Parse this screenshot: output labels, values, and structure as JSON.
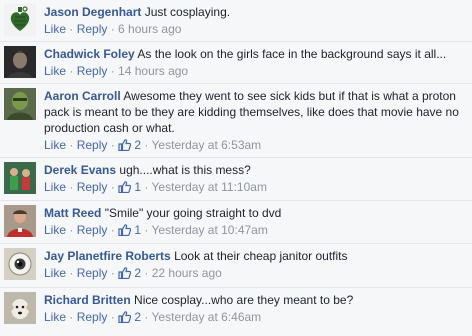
{
  "actions": {
    "like": "Like",
    "reply": "Reply",
    "sep": " · "
  },
  "comments": [
    {
      "author": "Jason Degenhart",
      "text": "Just cosplaying.",
      "likes": "",
      "time": "6 hours ago",
      "avatar_icon": "grenade-heart-icon",
      "avatar_bg": "#2e5a2a"
    },
    {
      "author": "Chadwick Foley",
      "text": "As the look on the girls face in the background says it all...",
      "likes": "",
      "time": "14 hours ago",
      "avatar_icon": "man-portrait-icon",
      "avatar_bg": "#2a2a2a"
    },
    {
      "author": "Aaron Carroll",
      "text": "Awesome they went to see sick kids but if that is what a proton pack is meant to be they are kidding themselves, like does that movie have no production cash or what.",
      "likes": "2",
      "time": "Yesterday at 6:53am",
      "avatar_icon": "green-character-icon",
      "avatar_bg": "#6a8a4a"
    },
    {
      "author": "Derek Evans",
      "text": "ugh....what is this mess?",
      "likes": "1",
      "time": "Yesterday at 11:10am",
      "avatar_icon": "costume-figures-icon",
      "avatar_bg": "#4a8a5a"
    },
    {
      "author": "Matt Reed",
      "text": "\"Smile\" your going straight to dvd",
      "likes": "1",
      "time": "Yesterday at 10:47am",
      "avatar_icon": "man-red-shirt-icon",
      "avatar_bg": "#9a8a7a"
    },
    {
      "author": "Jay Planetfire Roberts",
      "text": "Look at their cheap janitor outfits",
      "likes": "2",
      "time": "22 hours ago",
      "avatar_icon": "eyeball-icon",
      "avatar_bg": "#c8c4b8"
    },
    {
      "author": "Richard Britten",
      "text": "Nice cosplay...who are they meant to be?",
      "likes": "2",
      "time": "Yesterday at 6:46am",
      "avatar_icon": "dog-icon",
      "avatar_bg": "#b8b4a8"
    }
  ]
}
